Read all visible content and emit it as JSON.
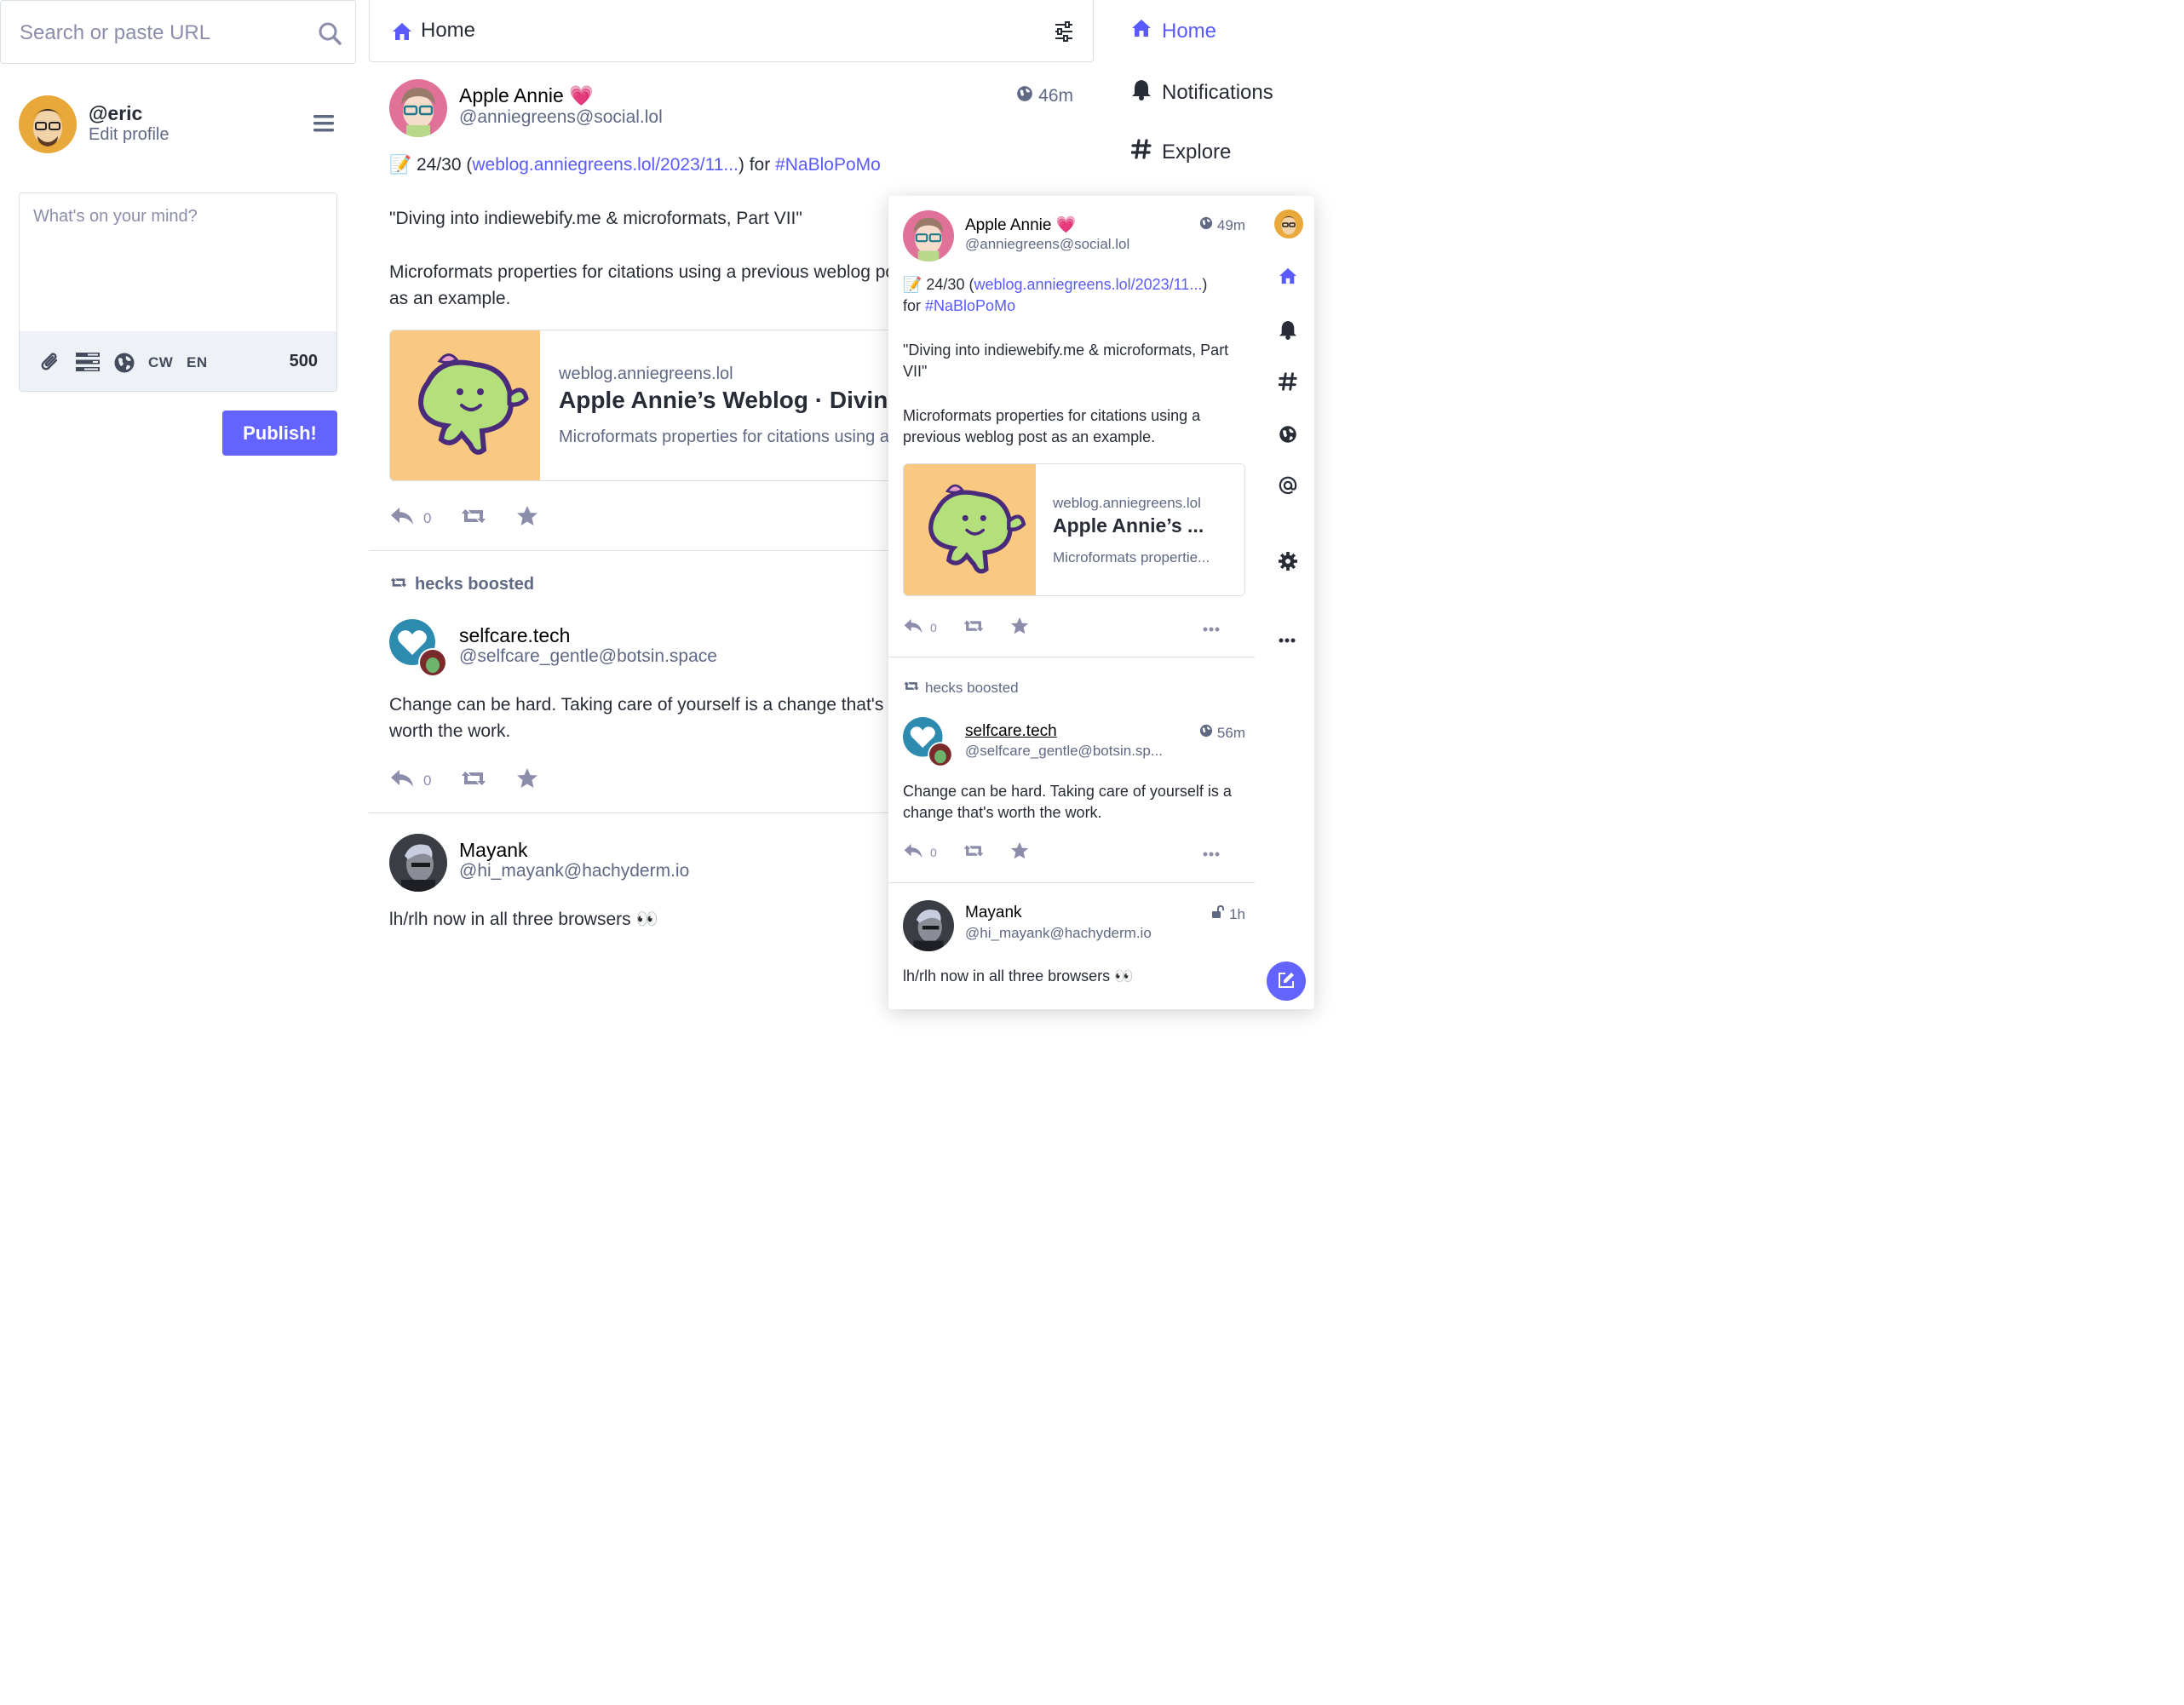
{
  "search": {
    "placeholder": "Search or paste URL"
  },
  "profile": {
    "handle": "@eric",
    "edit_label": "Edit profile"
  },
  "composer": {
    "placeholder": "What's on your mind?",
    "cw_label": "CW",
    "lang_label": "EN",
    "char_count": "500",
    "publish_label": "Publish!"
  },
  "column": {
    "title": "Home"
  },
  "nav": {
    "home": "Home",
    "notifications": "Notifications",
    "explore": "Explore"
  },
  "statuses": [
    {
      "name": "Apple Annie",
      "acct": "@anniegreens@social.lol",
      "time": "46m",
      "memo_emoji": "📝",
      "text_prefix": " 24/30 (",
      "link": "weblog.anniegreens.lol/2023/11...",
      "text_mid": ") for ",
      "hashtag": "#NaBloPoMo",
      "para2": "\"Diving into indiewebify.me & microformats, Part VII\"",
      "para3": "Microformats properties for citations using a previous weblog post as an example.",
      "card": {
        "host": "weblog.anniegreens.lol",
        "title": "Apple Annie’s Weblog · Diving",
        "desc": "Microformats properties for citations using a previous weblog post as an example."
      },
      "replies": "0"
    },
    {
      "boosted_by": "hecks boosted",
      "name": "selfcare.tech",
      "acct": "@selfcare_gentle@botsin.space",
      "text": "Change can be hard. Taking care of yourself is a change that's worth the work.",
      "replies": "0"
    },
    {
      "name": "Mayank",
      "acct": "@hi_mayank@hachyderm.io",
      "text": "lh/rlh now in all three browsers 👀"
    }
  ],
  "overlay": {
    "s1": {
      "name": "Apple Annie",
      "acct": "@anniegreens@social.lol",
      "time": "49m",
      "line1a": "📝 24/30 (",
      "link": "weblog.anniegreens.lol/2023/11...",
      "line1b": ")",
      "line2a": "for ",
      "hashtag": "#NaBloPoMo",
      "para2": "\"Diving into indiewebify.me & microformats, Part VII\"",
      "para3": "Microformats properties for citations using a previous weblog post as an example.",
      "card_host": "weblog.anniegreens.lol",
      "card_title": "Apple Annie’s ...",
      "card_desc": "Microformats propertie...",
      "replies": "0"
    },
    "s2": {
      "boosted_by": "hecks boosted",
      "name": "selfcare.tech",
      "acct": "@selfcare_gentle@botsin.sp...",
      "time": "56m",
      "text": "Change can be hard. Taking care of yourself is a change that's worth the work.",
      "replies": "0"
    },
    "s3": {
      "name": "Mayank",
      "acct": "@hi_mayank@hachyderm.io",
      "time": "1h",
      "text": "lh/rlh now in all three browsers 👀"
    }
  },
  "colors": {
    "accent": "#6364ff",
    "link": "#595aff",
    "text": "#282c37",
    "muted": "#606984",
    "icon": "#8c8daa"
  },
  "icons": [
    "search-icon",
    "hamburger-icon",
    "paperclip-icon",
    "poll-icon",
    "globe-icon",
    "home-icon",
    "sliders-icon",
    "bell-icon",
    "hash-icon",
    "reply-icon",
    "boost-icon",
    "star-icon",
    "ellipsis-icon",
    "at-icon",
    "gear-icon",
    "lock-open-icon",
    "compose-icon"
  ]
}
